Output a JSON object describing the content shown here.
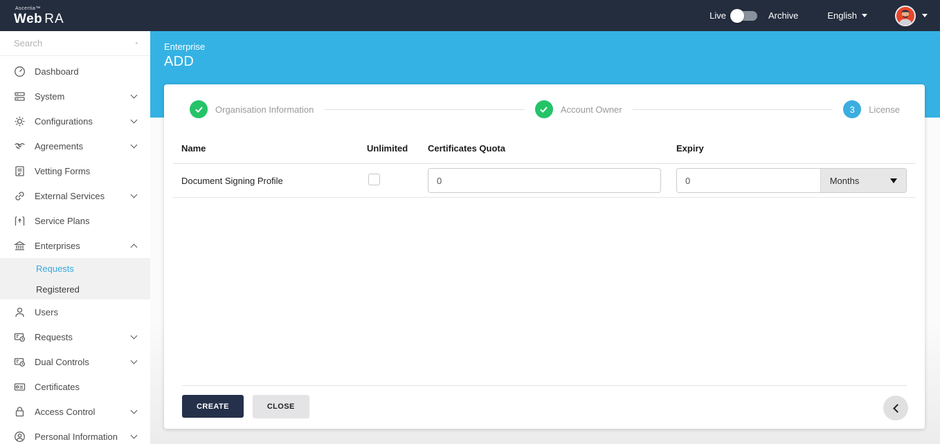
{
  "navbar": {
    "brand_top": "Ascertia™",
    "brand_web": "Web",
    "brand_ra": "RA",
    "live_label": "Live",
    "archive_label": "Archive",
    "language_label": "English"
  },
  "sidebar": {
    "search_placeholder": "Search",
    "items": [
      {
        "label": "Dashboard",
        "icon": "gauge-icon"
      },
      {
        "label": "System",
        "icon": "server-icon"
      },
      {
        "label": "Configurations",
        "icon": "gear-icon"
      },
      {
        "label": "Agreements",
        "icon": "handshake-icon"
      },
      {
        "label": "Vetting Forms",
        "icon": "form-icon"
      },
      {
        "label": "External Services",
        "icon": "link-icon"
      },
      {
        "label": "Service Plans",
        "icon": "service-plan-icon"
      },
      {
        "label": "Enterprises",
        "icon": "bank-icon"
      },
      {
        "label": "Users",
        "icon": "user-icon"
      },
      {
        "label": "Requests",
        "icon": "request-card-icon"
      },
      {
        "label": "Dual Controls",
        "icon": "dual-controls-icon"
      },
      {
        "label": "Certificates",
        "icon": "certificate-icon"
      },
      {
        "label": "Access Control",
        "icon": "lock-icon"
      },
      {
        "label": "Personal Information",
        "icon": "person-circle-icon"
      }
    ],
    "enterprises_children": [
      {
        "label": "Requests",
        "active": true
      },
      {
        "label": "Registered",
        "active": false
      }
    ]
  },
  "page_header": {
    "section": "Enterprise",
    "title": "ADD"
  },
  "stepper": {
    "steps": [
      {
        "label": "Organisation Information",
        "state": "complete"
      },
      {
        "label": "Account Owner",
        "state": "complete"
      },
      {
        "label": "License",
        "state": "current",
        "number": "3"
      }
    ]
  },
  "license_table": {
    "columns": {
      "name": "Name",
      "unlimited": "Unlimited",
      "quota": "Certificates Quota",
      "expiry": "Expiry"
    },
    "rows": [
      {
        "name": "Document Signing Profile",
        "unlimited_checked": false,
        "certificates_quota": "0",
        "expiry_value": "0",
        "expiry_unit": "Months"
      }
    ]
  },
  "actions": {
    "create_label": "CREATE",
    "close_label": "CLOSE"
  },
  "colors": {
    "navbar_bg": "#232d3e",
    "accent_blue": "#35b2e4",
    "success_green": "#25c368",
    "active_link_blue": "#36a9dd",
    "create_button_bg": "#25304a"
  }
}
